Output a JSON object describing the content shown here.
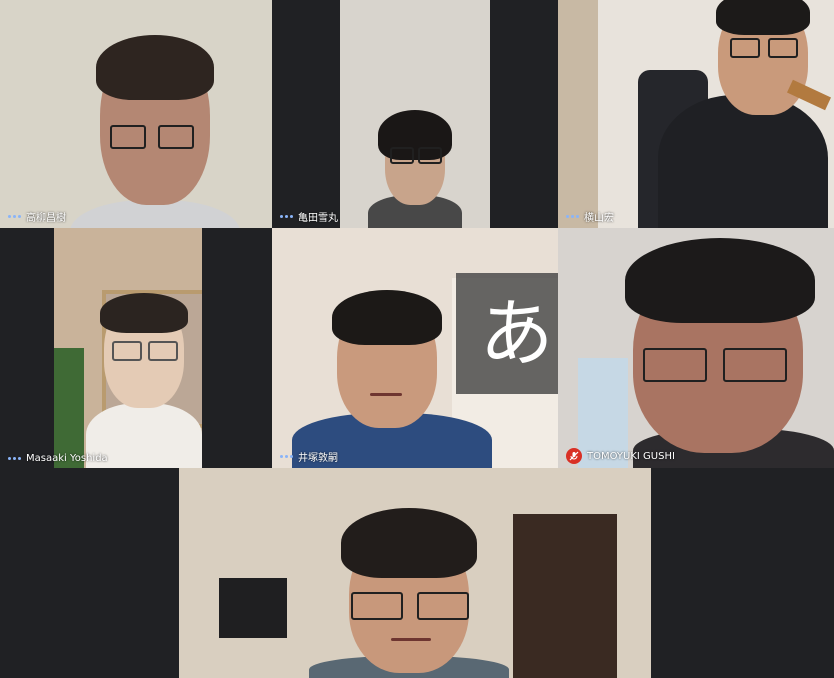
{
  "participants": [
    {
      "name": "高柳昌樹",
      "status": "speaking",
      "colors": {
        "bg": "#d8d4c8",
        "skin": "#b48773",
        "hair": "#2e2520",
        "shirt": "#d1d2d4"
      }
    },
    {
      "name": "亀田雪丸",
      "status": "speaking",
      "colors": {
        "bg": "#d8d4cd",
        "skin": "#c8a48b",
        "hair": "#1a1716",
        "shirt": "#484848"
      }
    },
    {
      "name": "横山宏",
      "status": "speaking",
      "colors": {
        "bg": "#e8e3dc",
        "skin": "#c99a7b",
        "hair": "#1c1a19",
        "shirt": "#1f2024"
      }
    },
    {
      "name": "Masaaki Yoshida",
      "status": "speaking",
      "colors": {
        "bg": "#c9b39a",
        "skin": "#e4cbb5",
        "hair": "#2b2420",
        "shirt": "#f0ede8"
      }
    },
    {
      "name": "井塚敦嗣",
      "status": "speaking",
      "colors": {
        "bg": "#e8dfd5",
        "skin": "#c99a7d",
        "hair": "#1c1917",
        "shirt": "#2d4c7f"
      }
    },
    {
      "name": "TOMOYUKI GUSHI",
      "status": "muted",
      "colors": {
        "bg": "#d7d3cf",
        "skin": "#a97462",
        "hair": "#1c1a1a",
        "shirt": "#2d2b2e"
      }
    },
    {
      "name": "",
      "status": "none",
      "colors": {
        "bg": "#d9cfc0",
        "skin": "#c8987b",
        "hair": "#221d1b",
        "shirt": "#596873"
      }
    }
  ],
  "overlay": {
    "glyph": "あ",
    "icon": "hiragana-glyph-icon"
  },
  "icons": {
    "speaking": "speaking-dots-icon",
    "muted": "mic-off-icon"
  },
  "colors": {
    "background": "#1f2022",
    "accent_dots": "#8ab4f8",
    "mic_off": "#d93025"
  }
}
